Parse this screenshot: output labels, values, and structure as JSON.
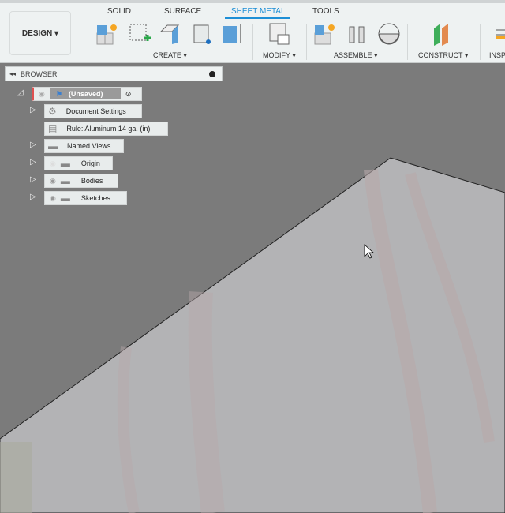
{
  "toolbar": {
    "workspace": "DESIGN ▾",
    "tabs": [
      "SOLID",
      "SURFACE",
      "SHEET METAL",
      "TOOLS"
    ],
    "active_tab": "SHEET METAL",
    "groups": [
      "CREATE ▾",
      "MODIFY ▾",
      "ASSEMBLE ▾",
      "CONSTRUCT ▾",
      "INSP"
    ]
  },
  "browser": {
    "title": "BROWSER",
    "root": "(Unsaved)",
    "items": [
      {
        "label": "Document Settings",
        "icon": "gear-icon"
      },
      {
        "label": "Rule: Aluminum 14 ga. (in)",
        "icon": "rule-icon"
      },
      {
        "label": "Named Views",
        "icon": "folder-icon"
      },
      {
        "label": "Origin",
        "icon": "folder-icon",
        "visible": false
      },
      {
        "label": "Bodies",
        "icon": "folder-icon",
        "visible": true
      },
      {
        "label": "Sketches",
        "icon": "folder-icon",
        "visible": true
      }
    ]
  },
  "colors": {
    "accent": "#1d8fd6",
    "viewport": "#7b7b7b",
    "plane": "#b3b3b5"
  }
}
